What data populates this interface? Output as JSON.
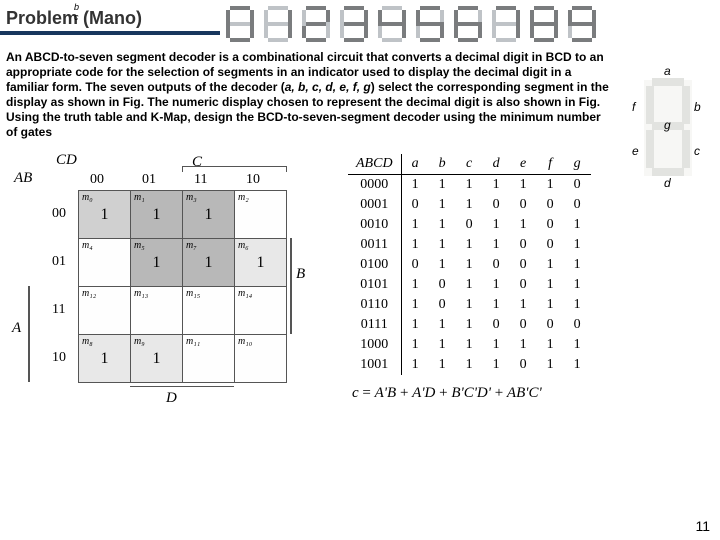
{
  "title": "Problem (Mano)",
  "seg_labels": {
    "b": "b",
    "c": "c"
  },
  "digits_patterns": [
    [
      1,
      1,
      1,
      1,
      1,
      1,
      0
    ],
    [
      0,
      1,
      1,
      0,
      0,
      0,
      0
    ],
    [
      1,
      1,
      0,
      1,
      1,
      0,
      1
    ],
    [
      1,
      1,
      1,
      1,
      0,
      0,
      1
    ],
    [
      0,
      1,
      1,
      0,
      0,
      1,
      1
    ],
    [
      1,
      0,
      1,
      1,
      0,
      1,
      1
    ],
    [
      1,
      0,
      1,
      1,
      1,
      1,
      1
    ],
    [
      1,
      1,
      1,
      0,
      0,
      0,
      0
    ],
    [
      1,
      1,
      1,
      1,
      1,
      1,
      1
    ],
    [
      1,
      1,
      1,
      1,
      0,
      1,
      1
    ]
  ],
  "problem_text_parts": {
    "p1": "An ABCD-to-seven segment decoder is a combinational circuit that converts a decimal digit in BCD to an appropriate code for the selection of segments in an indicator used to display the decimal digit in a familiar form. The seven outputs of the decoder (",
    "italic": "a, b, c, d, e, f, g",
    "p2": ") select the corresponding segment in the display as shown in Fig. The numeric display chosen to represent the decimal digit is also shown in Fig. Using the truth table and K-Map, design the BCD-to-seven-segment decoder using the minimum number of gates"
  },
  "segfig": {
    "a": "a",
    "b": "b",
    "c": "c",
    "d": "d",
    "e": "e",
    "f": "f",
    "g": "g"
  },
  "kmap": {
    "cd_label": "CD",
    "ab_label": "AB",
    "a_label": "A",
    "b_label": "B",
    "c_label": "C",
    "d_label": "D",
    "cols": [
      "00",
      "01",
      "11",
      "10"
    ],
    "rows": [
      "00",
      "01",
      "11",
      "10"
    ],
    "mlabels": [
      [
        "m₀",
        "m₁",
        "m₃",
        "m₂"
      ],
      [
        "m₄",
        "m₅",
        "m₇",
        "m₆"
      ],
      [
        "m₁₂",
        "m₁₃",
        "m₁₅",
        "m₁₄"
      ],
      [
        "m₈",
        "m₉",
        "m₁₁",
        "m₁₀"
      ]
    ],
    "vals": [
      [
        "1",
        "1",
        "1",
        ""
      ],
      [
        "",
        "1",
        "1",
        "1"
      ],
      [
        "",
        "",
        "",
        ""
      ],
      [
        "1",
        "1",
        "",
        ""
      ]
    ]
  },
  "truth": {
    "headers": [
      "ABCD",
      "a",
      "b",
      "c",
      "d",
      "e",
      "f",
      "g"
    ],
    "rows": [
      [
        "0000",
        "1",
        "1",
        "1",
        "1",
        "1",
        "1",
        "0"
      ],
      [
        "0001",
        "0",
        "1",
        "1",
        "0",
        "0",
        "0",
        "0"
      ],
      [
        "0010",
        "1",
        "1",
        "0",
        "1",
        "1",
        "0",
        "1"
      ],
      [
        "0011",
        "1",
        "1",
        "1",
        "1",
        "0",
        "0",
        "1"
      ],
      [
        "0100",
        "0",
        "1",
        "1",
        "0",
        "0",
        "1",
        "1"
      ],
      [
        "0101",
        "1",
        "0",
        "1",
        "1",
        "0",
        "1",
        "1"
      ],
      [
        "0110",
        "1",
        "0",
        "1",
        "1",
        "1",
        "1",
        "1"
      ],
      [
        "0111",
        "1",
        "1",
        "1",
        "0",
        "0",
        "0",
        "0"
      ],
      [
        "1000",
        "1",
        "1",
        "1",
        "1",
        "1",
        "1",
        "1"
      ],
      [
        "1001",
        "1",
        "1",
        "1",
        "1",
        "0",
        "1",
        "1"
      ]
    ]
  },
  "equation_parts": {
    "lhs": "c",
    "eq": " = ",
    "t1": "A'B",
    "plus": " + ",
    "t2": "A'D",
    "t3": "B'C'D'",
    "t4": "AB'C'"
  },
  "page_number": "11"
}
